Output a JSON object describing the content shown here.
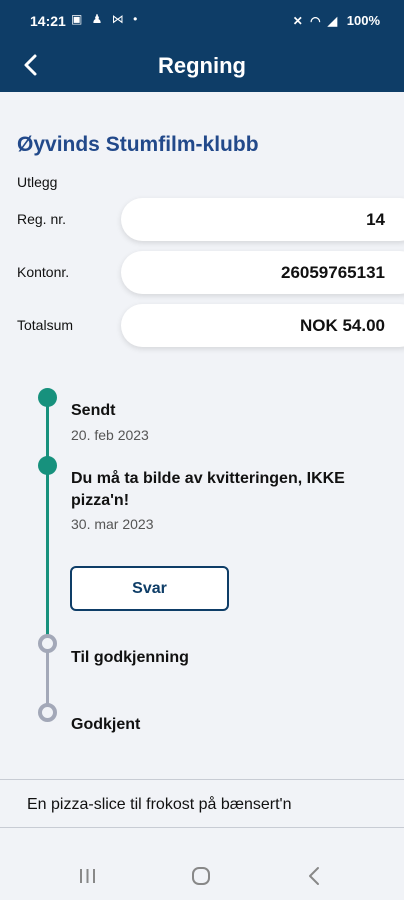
{
  "statusbar": {
    "time": "14:21",
    "notification_icons": "▣ ♟ ⋈ •",
    "status_icons": "✕ ◠ ◢",
    "battery": "100%"
  },
  "appbar": {
    "title": "Regning"
  },
  "club_name": "Øyvinds Stumfilm-klubb",
  "expense_type": "Utlegg",
  "fields": [
    {
      "label": "Reg. nr.",
      "value": "14"
    },
    {
      "label": "Kontonr.",
      "value": "26059765131"
    },
    {
      "label": "Totalsum",
      "value": "NOK 54.00"
    }
  ],
  "timeline": [
    {
      "title": "Sendt",
      "date": "20. feb 2023",
      "done": true
    },
    {
      "title": "Du må ta bilde av kvitteringen, IKKE pizza'n!",
      "date": "30. mar 2023",
      "done": true
    },
    {
      "title": "Til godkjenning",
      "date": "",
      "done": false
    },
    {
      "title": "Godkjent",
      "date": "",
      "done": false
    }
  ],
  "reply_button": "Svar",
  "description": "En pizza-slice til frokost på bænsert'n",
  "colors": {
    "primary": "#0e3d67",
    "accent": "#17917d",
    "club": "#22498a",
    "pending": "#a3a8b8",
    "background": "#f1f3f7"
  }
}
